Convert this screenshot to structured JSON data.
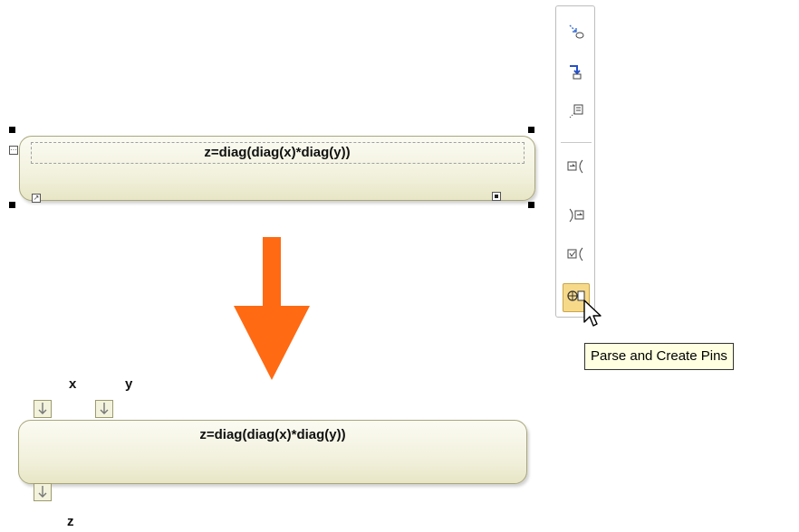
{
  "top_action": {
    "expression": "z=diag(diag(x)*diag(y))"
  },
  "bottom_action": {
    "expression": "z=diag(diag(x)*diag(y))",
    "input_pins": [
      "x",
      "y"
    ],
    "output_pins": [
      "z"
    ]
  },
  "toolbar": {
    "buttons": [
      {
        "icon": "connector-icon"
      },
      {
        "icon": "control-flow-icon"
      },
      {
        "icon": "note-anchor-icon"
      },
      {
        "icon": "input-pin-icon"
      },
      {
        "icon": "output-pin-icon"
      },
      {
        "icon": "value-pin-icon"
      },
      {
        "icon": "parse-create-pins-icon",
        "active": true
      }
    ]
  },
  "tooltip": {
    "text": "Parse and Create Pins"
  },
  "colors": {
    "arrow": "#ff6a13",
    "shape_border": "#a8a77a",
    "shape_fill": "#f2f1dd",
    "tooltip_bg": "#ffffe1",
    "active_button": "#f7d98a"
  }
}
